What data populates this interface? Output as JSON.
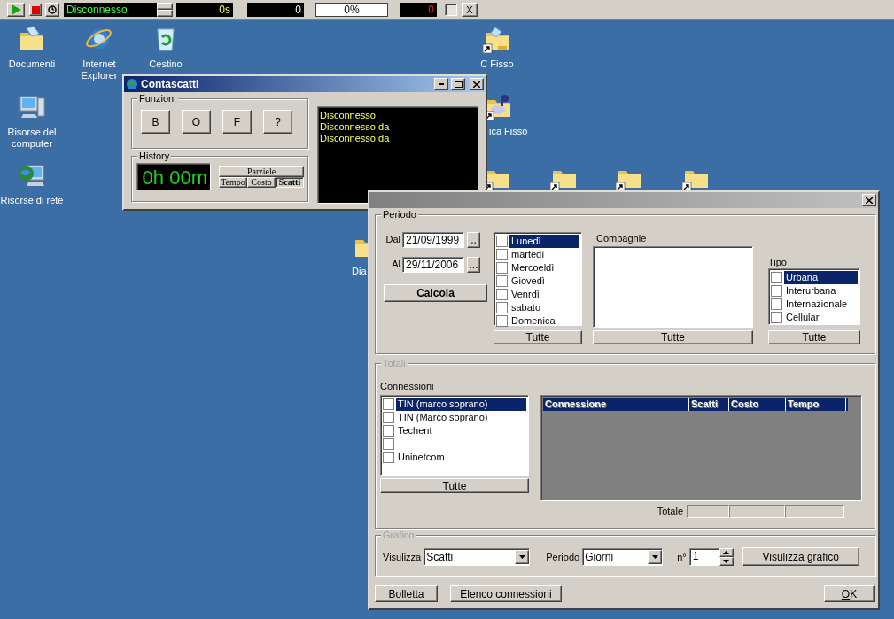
{
  "toolbar": {
    "status": "Disconnesso",
    "duration": "0s",
    "counter": "0",
    "progress": {
      "label": "0%",
      "level": 0
    },
    "alarm": "0",
    "option_checked": false,
    "close_label": "X"
  },
  "desktop_icons": [
    {
      "label": "Documenti",
      "kind": "documents",
      "shortcut": false
    },
    {
      "label": "Internet Explorer",
      "kind": "browser",
      "shortcut": false
    },
    {
      "label": "Cestino",
      "kind": "recycle",
      "shortcut": false
    },
    {
      "label": "Risorse del computer",
      "kind": "computer",
      "shortcut": false
    },
    {
      "label": "Risorse di rete",
      "kind": "network",
      "shortcut": false
    },
    {
      "label": "C Fisso",
      "kind": "shared",
      "shortcut": true
    },
    {
      "label": "ica Fisso",
      "kind": "music",
      "shortcut": true
    },
    {
      "kind": "folder",
      "shortcut": true
    },
    {
      "kind": "folder",
      "shortcut": true
    },
    {
      "kind": "folder",
      "shortcut": true
    },
    {
      "kind": "folder",
      "shortcut": true
    },
    {
      "label": "Dia",
      "kind": "folder",
      "shortcut": false
    }
  ],
  "contascatti": {
    "title": "Contascatti",
    "functions": {
      "title": "Funzioni",
      "buttons": [
        "B",
        "O",
        "F",
        "?"
      ]
    },
    "history": {
      "title": "History",
      "display": "0h 00m",
      "partial_label": "Parziele",
      "modes": [
        {
          "label": "Tempo",
          "selected": false
        },
        {
          "label": "Costo",
          "selected": false
        },
        {
          "label": "Scatti",
          "selected": true
        }
      ]
    },
    "log": [
      "Disconnesso.",
      "Disconnesso da",
      "Disconnesso da"
    ]
  },
  "dialog": {
    "period": {
      "title": "Periodo",
      "disabled": false,
      "from": {
        "label": "Dal",
        "value": "21/09/1999",
        "button": ".."
      },
      "to": {
        "label": "Al",
        "value": "29/11/2006",
        "button": "..."
      },
      "calculate": "Calcola",
      "days": {
        "items": [
          {
            "label": "Lunedì",
            "checked": false,
            "selected": true
          },
          {
            "label": "martedì",
            "checked": false,
            "selected": false
          },
          {
            "label": "Mercoeldì",
            "checked": false,
            "selected": false
          },
          {
            "label": "Giovedì",
            "checked": false,
            "selected": false
          },
          {
            "label": "Venrdì",
            "checked": false,
            "selected": false
          },
          {
            "label": "sabato",
            "checked": false,
            "selected": false
          },
          {
            "label": "Domenica",
            "checked": false,
            "selected": false
          }
        ],
        "all_button": "Tutte"
      },
      "companies": {
        "label": "Compagnie",
        "all_button": "Tutte"
      },
      "type": {
        "label": "Tipo",
        "items": [
          {
            "label": "Urbana",
            "checked": false,
            "selected": true
          },
          {
            "label": "Interurbana",
            "checked": false,
            "selected": false
          },
          {
            "label": "Internazionale",
            "checked": false,
            "selected": false
          },
          {
            "label": "Cellulari",
            "checked": false,
            "selected": false
          }
        ],
        "all_button": "Tutte"
      }
    },
    "totals": {
      "title": "Totali",
      "disabled": true,
      "connections": {
        "label": "Connessioni",
        "items": [
          {
            "label": "TIN (marco soprano)",
            "checked": false,
            "selected": true
          },
          {
            "label": "TIN (Marco soprano)",
            "checked": false,
            "selected": false
          },
          {
            "label": "Techent",
            "checked": false,
            "selected": false
          },
          {
            "checked": false,
            "selected": false
          },
          {
            "label": "Uninetcom",
            "checked": false,
            "selected": false
          }
        ],
        "all_button": "Tutte"
      },
      "grid": {
        "columns": [
          "Connessione",
          "Scatti",
          "Costo",
          "Tempo"
        ]
      },
      "total_label": "Totale"
    },
    "chart": {
      "title": "Grafico",
      "disabled": true,
      "show_label": "Visulizza",
      "show_value": "Scatti",
      "period_label": "Periodo",
      "period_value": "Giorni",
      "count_label": "n°",
      "count_value": "1",
      "button": "Visulizza grafico"
    },
    "buttons": [
      "Bolletta",
      "Elenco connessioni",
      "OK"
    ]
  }
}
